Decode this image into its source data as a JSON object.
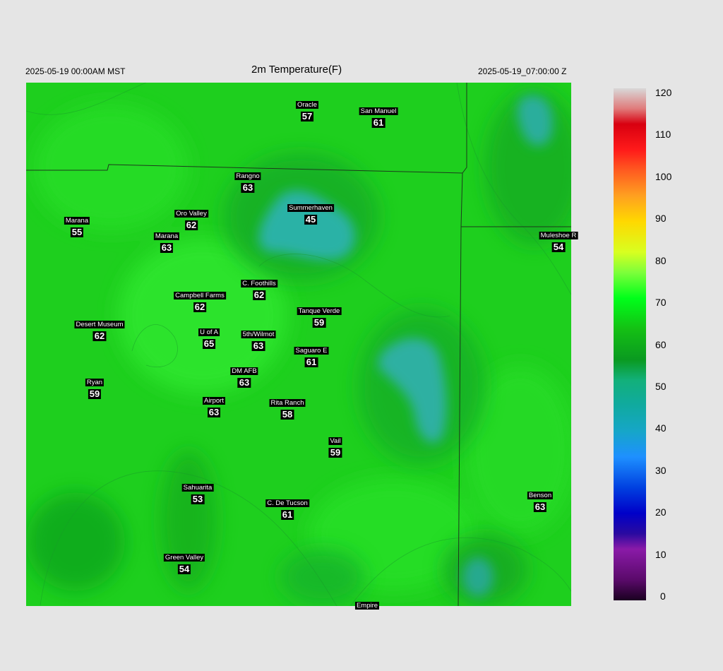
{
  "header": {
    "local_time": "2025-05-19 00:00AM MST",
    "title": "2m Temperature(F)",
    "utc_time": "2025-05-19_07:00:00 Z"
  },
  "stations": [
    {
      "name": "Oracle",
      "value": "57"
    },
    {
      "name": "San Manuel",
      "value": "61"
    },
    {
      "name": "Rangno",
      "value": "63"
    },
    {
      "name": "Summerhaven",
      "value": "45"
    },
    {
      "name": "Marana",
      "value": "55"
    },
    {
      "name": "Oro Valley",
      "value": "62"
    },
    {
      "name": "Marana",
      "value": "63"
    },
    {
      "name": "Muleshoe R",
      "value": "54"
    },
    {
      "name": "C. Foothills",
      "value": "62"
    },
    {
      "name": "Campbell Farms",
      "value": "62"
    },
    {
      "name": "Tanque Verde",
      "value": "59"
    },
    {
      "name": "Desert Museum",
      "value": "62"
    },
    {
      "name": "U of A",
      "value": "65"
    },
    {
      "name": "5th/Wilmot",
      "value": "63"
    },
    {
      "name": "Saguaro E",
      "value": "61"
    },
    {
      "name": "DM AFB",
      "value": "63"
    },
    {
      "name": "Ryan",
      "value": "59"
    },
    {
      "name": "Airport",
      "value": "63"
    },
    {
      "name": "Rita Ranch",
      "value": "58"
    },
    {
      "name": "Vail",
      "value": "59"
    },
    {
      "name": "Sahuarita",
      "value": "53"
    },
    {
      "name": "C. De Tucson",
      "value": "61"
    },
    {
      "name": "Benson",
      "value": "63"
    },
    {
      "name": "Green Valley",
      "value": "54"
    },
    {
      "name": "Empire",
      "value": ""
    }
  ],
  "colorbar": {
    "min": 0,
    "max": 120,
    "ticks": [
      "120",
      "110",
      "100",
      "90",
      "80",
      "70",
      "60",
      "50",
      "40",
      "30",
      "20",
      "10",
      "0"
    ]
  },
  "colors": {
    "background": "#e5e5e5",
    "map_green": "#1fd11f",
    "cool_teal": "#2fb0b0"
  }
}
